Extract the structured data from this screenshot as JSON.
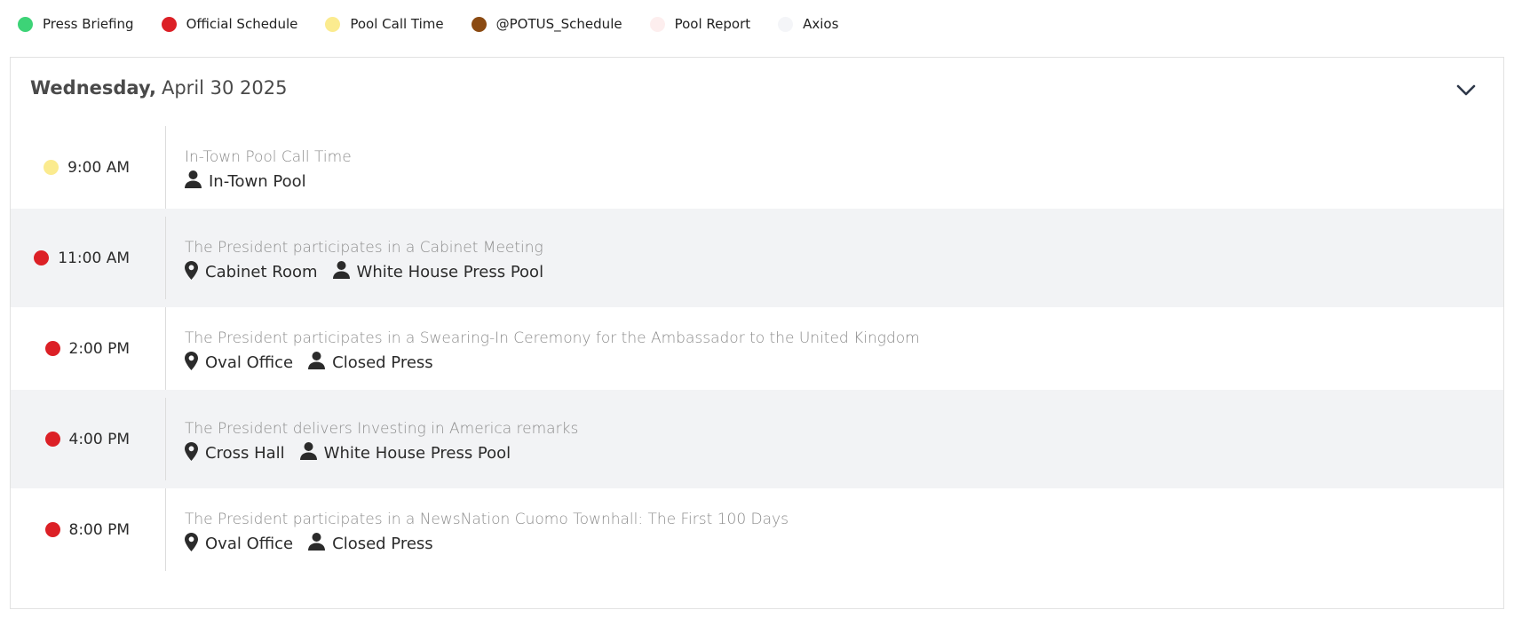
{
  "legend": [
    {
      "label": "Press Briefing",
      "color": "#3dd377"
    },
    {
      "label": "Official Schedule",
      "color": "#dc2026"
    },
    {
      "label": "Pool Call Time",
      "color": "#fbeb8f"
    },
    {
      "label": "@POTUS_Schedule",
      "color": "#8b4a12"
    },
    {
      "label": "Pool Report",
      "color": "#fdeeee"
    },
    {
      "label": "Axios",
      "color": "#f4f5f8"
    }
  ],
  "day": {
    "weekday": "Wednesday,",
    "date": "April 30 2025",
    "toggle_icon": "chevron-down-icon"
  },
  "events": [
    {
      "time": "9:00 AM",
      "dot_color": "#fbeb8f",
      "title": "In-Town Pool Call Time",
      "location": "",
      "coverage": "In-Town Pool"
    },
    {
      "time": "11:00 AM",
      "dot_color": "#dc2026",
      "title": "The President participates in a Cabinet Meeting",
      "location": "Cabinet Room",
      "coverage": "White House Press Pool"
    },
    {
      "time": "2:00 PM",
      "dot_color": "#dc2026",
      "title": "The President participates in a Swearing-In Ceremony for the Ambassador to the United Kingdom",
      "location": "Oval Office",
      "coverage": "Closed Press"
    },
    {
      "time": "4:00 PM",
      "dot_color": "#dc2026",
      "title": "The President delivers Investing in America remarks",
      "location": "Cross Hall",
      "coverage": "White House Press Pool"
    },
    {
      "time": "8:00 PM",
      "dot_color": "#dc2026",
      "title": "The President participates in a NewsNation Cuomo Townhall: The First 100 Days",
      "location": "Oval Office",
      "coverage": "Closed Press"
    }
  ]
}
